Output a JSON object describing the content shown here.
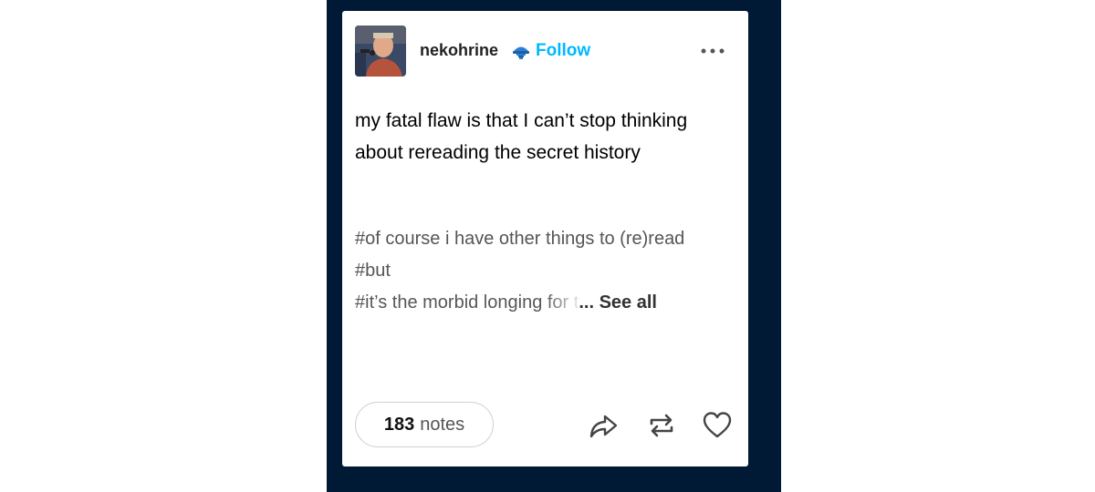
{
  "post": {
    "username": "nekohrine",
    "follow_label": "Follow",
    "body": "my fatal flaw is that I can’t stop thinking about rereading the secret history",
    "tags": [
      "#of course i have other things to (re)read",
      "#but"
    ],
    "truncated_tag": "#it’s the morbid longing for t",
    "ellipsis": "...",
    "see_all_label": "See all",
    "notes_count": "183",
    "notes_label": "notes"
  },
  "icons": {
    "badge": "blue-hat-badge-icon",
    "more": "more-options-icon",
    "share": "share-icon",
    "reblog": "reblog-icon",
    "like": "heart-icon"
  },
  "colors": {
    "backdrop": "#001935",
    "follow": "#00b8ff",
    "tag_text": "#555555"
  }
}
